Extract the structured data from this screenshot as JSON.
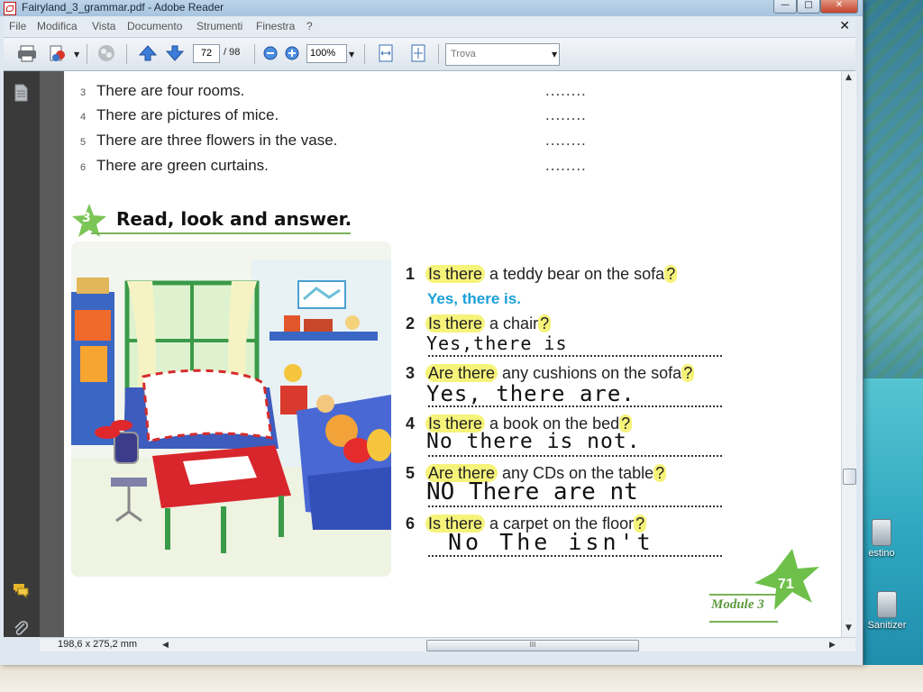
{
  "window": {
    "title": "Fairyland_3_grammar.pdf - Adobe Reader"
  },
  "menu": [
    "File",
    "Modifica",
    "Vista",
    "Documento",
    "Strumenti",
    "Finestra",
    "?"
  ],
  "toolbar": {
    "page_current": "72",
    "page_total": "/ 98",
    "zoom": "100%",
    "find_placeholder": "Trova"
  },
  "status": {
    "page_size": "198,6 x 275,2 mm",
    "hscroll_grip": "III"
  },
  "desktop_icons": [
    {
      "label": "estino"
    },
    {
      "label": "Sanitizer"
    }
  ],
  "document": {
    "prev_exercise_lines": [
      {
        "num": "3",
        "text": "There are four rooms.",
        "blank": "........"
      },
      {
        "num": "4",
        "text": "There are pictures of mice.",
        "blank": "........"
      },
      {
        "num": "5",
        "text": "There are three flowers in the vase.",
        "blank": "........"
      },
      {
        "num": "6",
        "text": "There are green curtains.",
        "blank": "........"
      }
    ],
    "exercise_number": "3",
    "exercise_title": "Read, look and answer.",
    "example_answer": "Yes, there is.",
    "questions": [
      {
        "num": "1",
        "lead": "Is there",
        "rest": " a teddy bear on the sofa",
        "qmark": "?",
        "handwritten": ""
      },
      {
        "num": "2",
        "lead": "Is there",
        "rest": " a chair",
        "qmark": "?",
        "handwritten": "Yes,there is"
      },
      {
        "num": "3",
        "lead": "Are there",
        "rest": " any cushions on the sofa",
        "qmark": "?",
        "handwritten": "Yes, there are."
      },
      {
        "num": "4",
        "lead": "Is there",
        "rest": " a book on the bed",
        "qmark": "?",
        "handwritten": "No there is not."
      },
      {
        "num": "5",
        "lead": "Are there",
        "rest": " any CDs on the table",
        "qmark": "?",
        "handwritten": "NO There are nt"
      },
      {
        "num": "6",
        "lead": "Is there",
        "rest": " a carpet on the floor",
        "qmark": "?",
        "handwritten": "No The isn't"
      }
    ],
    "module_label": "Module 3",
    "page_number": "71"
  },
  "colors": {
    "highlight": "#f6f37a",
    "example_blue": "#1aa0d8",
    "module_green": "#5c9a3e",
    "star_green": "#6fc04a"
  }
}
